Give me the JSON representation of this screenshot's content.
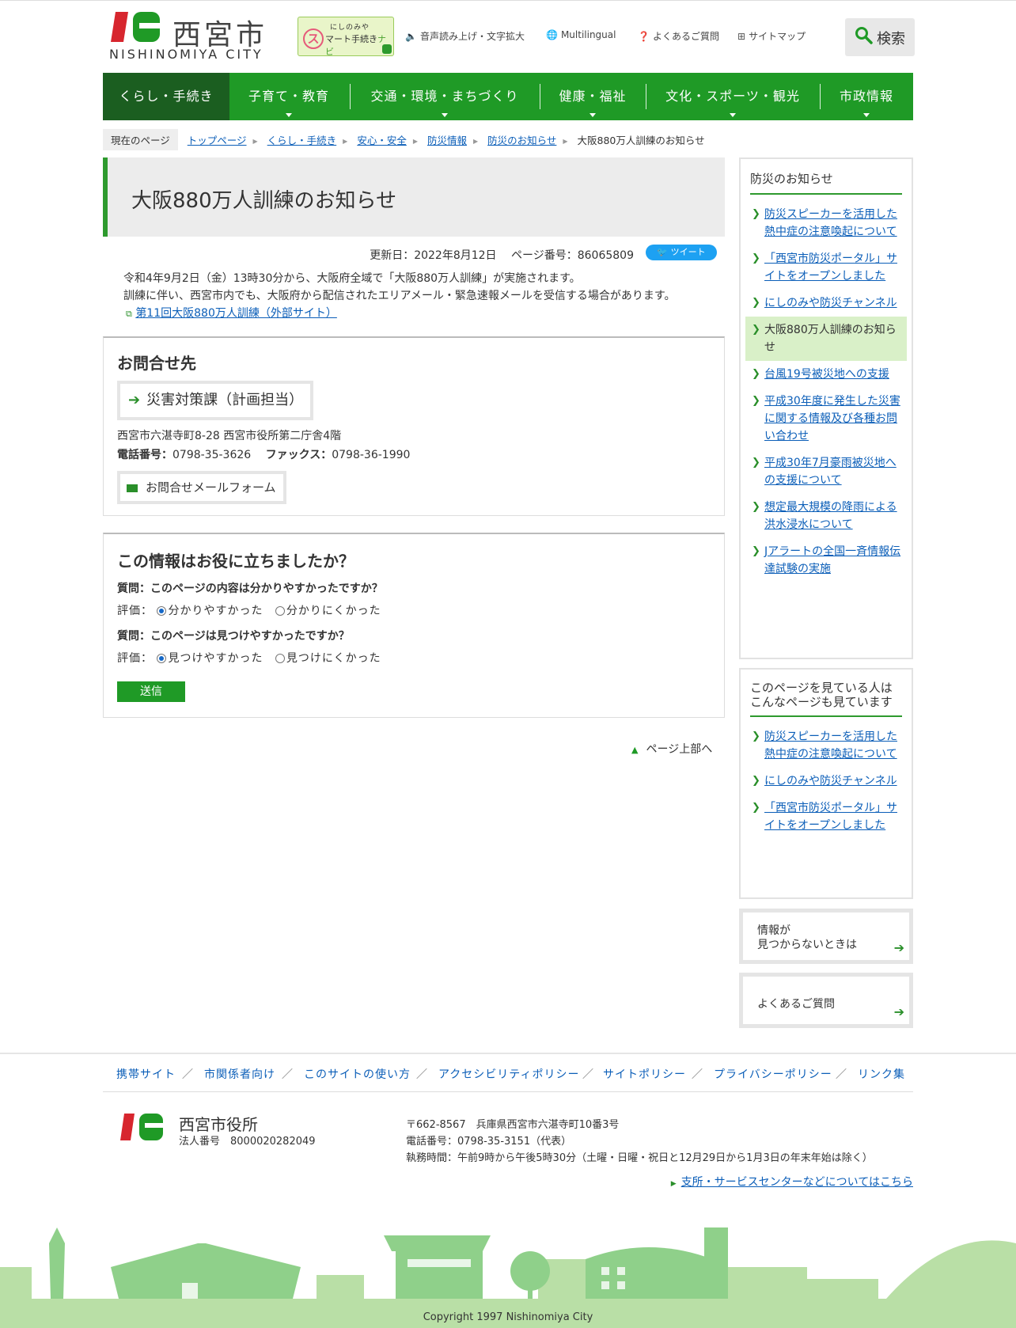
{
  "header": {
    "city_name": "西宮市",
    "city_name_en": "NISHINOMIYA CITY",
    "navi_line1": "にしのみや",
    "navi_line2_a": "マート手続き",
    "navi_line2_b": "ナビ",
    "navi_initial": "ス",
    "utility": [
      {
        "icon": "speaker-icon",
        "label": "音声読み上げ・文字拡大"
      },
      {
        "icon": "translate-icon",
        "label": "Multilingual"
      },
      {
        "icon": "question-icon",
        "label": "よくあるご質問"
      },
      {
        "icon": "sitemap-icon",
        "label": "サイトマップ"
      }
    ],
    "search_label": "検索"
  },
  "gnav": [
    {
      "label": "くらし・手続き",
      "active": true
    },
    {
      "label": "子育て・教育"
    },
    {
      "label": "交通・環境・まちづくり"
    },
    {
      "label": "健康・福祉"
    },
    {
      "label": "文化・スポーツ・観光"
    },
    {
      "label": "市政情報"
    }
  ],
  "breadcrumb": {
    "current_label": "現在のページ",
    "items": [
      "トップページ",
      "くらし・手続き",
      "安心・安全",
      "防災情報",
      "防災のお知らせ"
    ],
    "current": "大阪880万人訓練のお知らせ"
  },
  "article": {
    "title": "大阪880万人訓練のお知らせ",
    "updated": "更新日：2022年8月12日",
    "page_number": "ページ番号：86065809",
    "tweet_label": "ツイート",
    "paragraph1": "令和4年9月2日（金）13時30分から、大阪府全域で「大阪880万人訓練」が実施されます。",
    "paragraph2": "訓練に伴い、西宮市内でも、大阪府から配信されたエリアメール・緊急速報メールを受信する場合があります。",
    "external_link": "第11回大阪880万人訓練（外部サイト）"
  },
  "contact": {
    "heading": "お問合せ先",
    "department": "災害対策課（計画担当）",
    "address": "西宮市六湛寺町8-28 西宮市役所第二庁舎4階",
    "tel_label": "電話番号：",
    "tel": "0798-35-3626",
    "fax_label": "ファックス：",
    "fax": "0798-36-1990",
    "mail_form": "お問合せメールフォーム"
  },
  "survey": {
    "heading": "この情報はお役に立ちましたか？",
    "q1": "質問：このページの内容は分かりやすかったですか？",
    "q2": "質問：このページは見つけやすかったですか？",
    "rating_label": "評価：",
    "q1_options": [
      "分かりやすかった",
      "分かりにくかった"
    ],
    "q2_options": [
      "見つけやすかった",
      "見つけにくかった"
    ],
    "submit": "送信"
  },
  "to_top": "ページ上部へ",
  "side1": {
    "heading": "防災のお知らせ",
    "items": [
      "防災スピーカーを活用した熱中症の注意喚起について",
      "「西宮市防災ポータル」サイトをオープンしました",
      "にしのみや防災チャンネル",
      "大阪880万人訓練のお知らせ",
      "台風19号被災地への支援",
      "平成30年度に発生した災害に関する情報及び各種お問い合わせ",
      "平成30年7月豪雨被災地への支援について",
      "想定最大規模の降雨による洪水浸水について",
      "Jアラートの全国一斉情報伝達試験の実施"
    ]
  },
  "side2": {
    "heading_line1": "このページを見ている人は",
    "heading_line2": "こんなページも見ています",
    "items": [
      "防災スピーカーを活用した熱中症の注意喚起について",
      "にしのみや防災チャンネル",
      "「西宮市防災ポータル」サイトをオープンしました"
    ]
  },
  "side_buttons": {
    "notfound_line1": "情報が",
    "notfound_line2": "見つからないときは",
    "faq": "よくあるご質問"
  },
  "footer": {
    "links": [
      "携帯サイト",
      "市関係者向け",
      "このサイトの使い方",
      "アクセシビリティポリシー",
      "サイトポリシー",
      "プライバシーポリシー",
      "リンク集"
    ],
    "office_name": "西宮市役所",
    "corp_number": "法人番号　8000020282049",
    "postal": "〒662-8567　兵庫県西宮市六湛寺町10番3号",
    "phone": "電話番号：0798-35-3151（代表）",
    "hours": "執務時間：午前9時から午後5時30分（土曜・日曜・祝日と12月29日から1月3日の年末年始は除く）",
    "branch_link": "支所・サービスセンターなどについてはこちら",
    "copyright": "Copyright 1997 Nishinomiya City"
  },
  "colors": {
    "brand_green": "#1f9a26",
    "active_nav": "#1b5e20",
    "link": "#0b5eb8",
    "logo_red": "#d7262e"
  }
}
